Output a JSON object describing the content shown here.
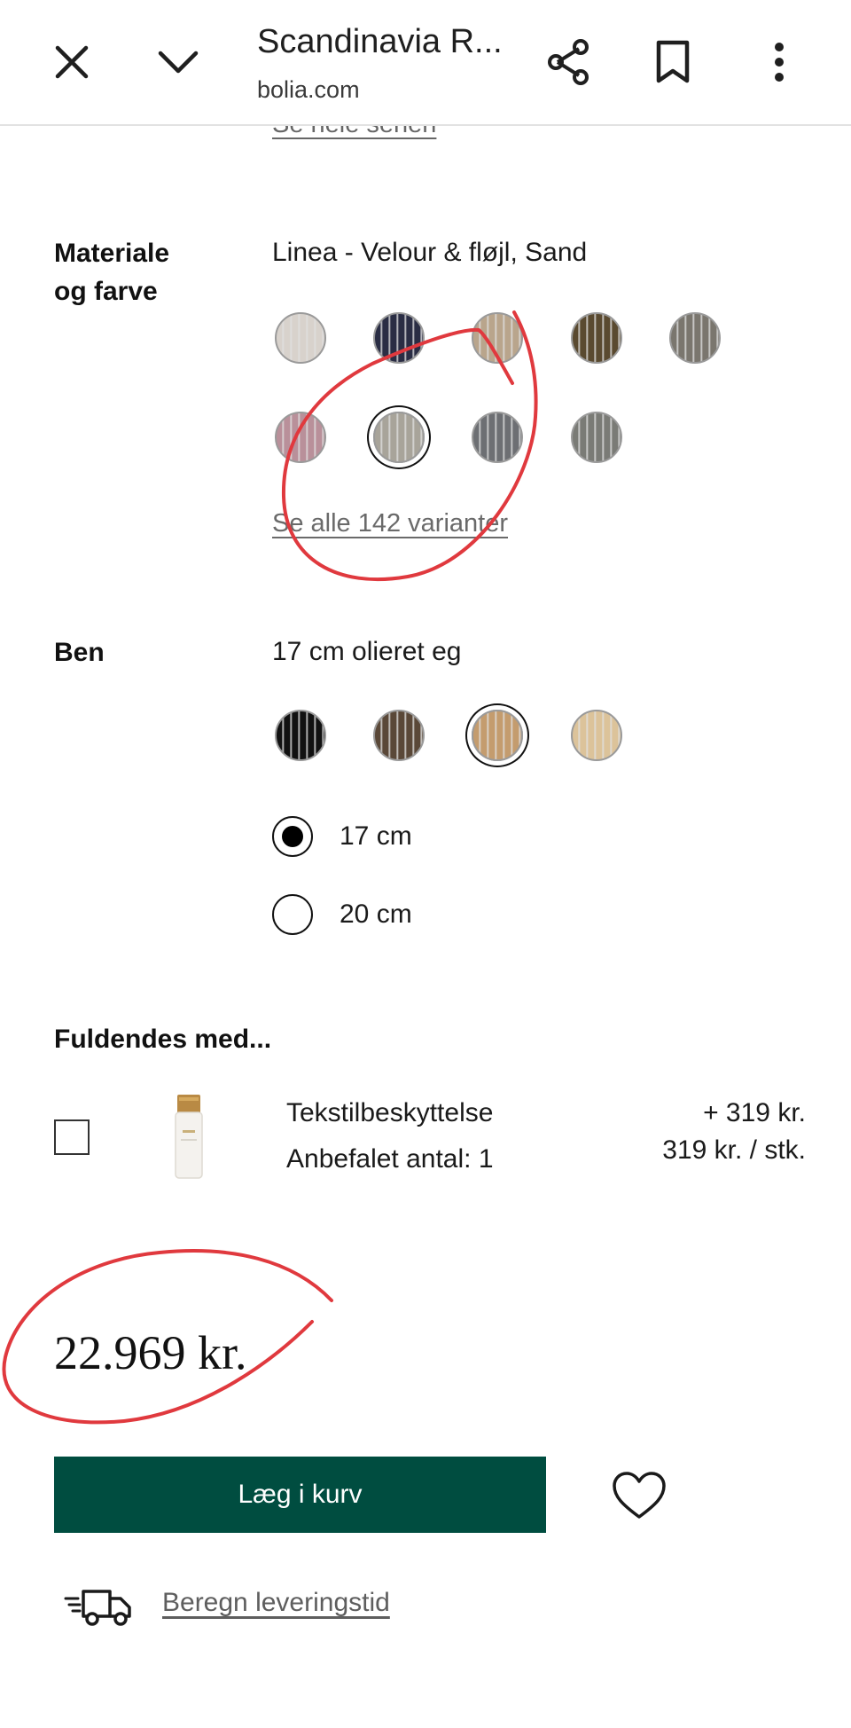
{
  "browser": {
    "title": "Scandinavia R...",
    "url": "bolia.com",
    "icons": [
      "close-icon",
      "chevron-down-icon",
      "share-icon",
      "bookmark-icon",
      "more-vert-icon"
    ]
  },
  "series_link": "Se hele serien",
  "material": {
    "label_line1": "Materiale",
    "label_line2": "og farve",
    "selected": "Linea - Velour & fløjl, Sand",
    "swatch_colors": [
      "#d8d2cc",
      "#2a2d44",
      "#b9a58c",
      "#5a4a30",
      "#7a766e",
      "#b9909a",
      "#a8a49a",
      "#6d6f73",
      "#7a7b76"
    ],
    "selected_index": 6,
    "see_all": "Se alle 142 varianter"
  },
  "legs": {
    "label": "Ben",
    "selected": "17 cm olieret eg",
    "swatch_colors": [
      "#111111",
      "#5a4838",
      "#c49c6e",
      "#dcc39a"
    ],
    "selected_index": 2,
    "options": [
      {
        "label": "17 cm",
        "checked": true
      },
      {
        "label": "20 cm",
        "checked": false
      }
    ]
  },
  "addons": {
    "heading": "Fuldendes med...",
    "item": {
      "name": "Tekstilbeskyttelse",
      "recommended": "Anbefalet antal: 1",
      "price": "+ 319 kr.",
      "unit_price": "319 kr. / stk.",
      "checked": false
    }
  },
  "price": "22.969 kr.",
  "cart_button": "Læg i kurv",
  "delivery_link": "Beregn leveringstid",
  "colors": {
    "accent": "#004d40",
    "annotation": "#e0393e"
  }
}
